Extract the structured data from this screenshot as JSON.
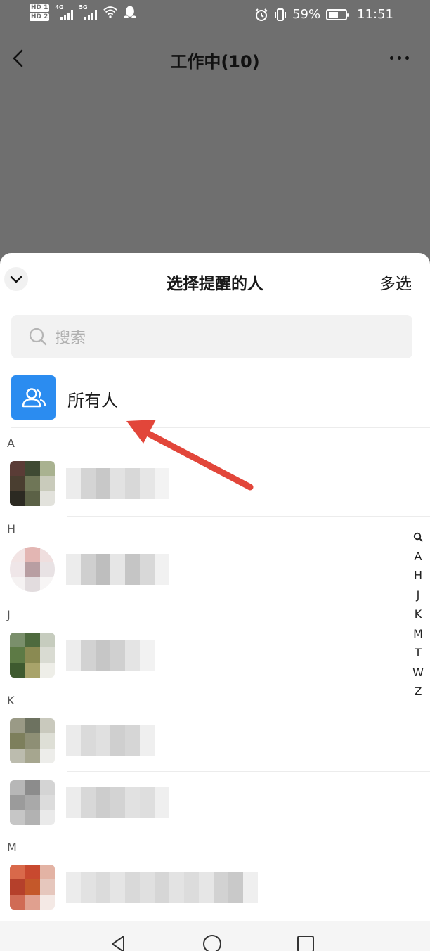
{
  "status_bar": {
    "sim1": "HD 1",
    "sim2": "HD 2",
    "net1": "4G",
    "net2": "5G",
    "battery": "59%",
    "battery_level": 0.59,
    "time": "11:51"
  },
  "topbar": {
    "title": "工作中(10)",
    "back_icon": "chevron-left-icon",
    "more_icon": "more-icon"
  },
  "sheet": {
    "title": "选择提醒的人",
    "multi_select": "多选",
    "collapse_icon": "chevron-down-icon",
    "search": {
      "placeholder": "搜索",
      "icon": "search-icon"
    },
    "all": {
      "label": "所有人",
      "icon": "group-icon",
      "accent": "#2b8cf0"
    },
    "sections": [
      {
        "letter": "A"
      },
      {
        "letter": "H"
      },
      {
        "letter": "J"
      },
      {
        "letter": "K"
      },
      {
        "letter": "M"
      }
    ],
    "index": [
      "A",
      "H",
      "J",
      "K",
      "M",
      "T",
      "W",
      "Z"
    ]
  },
  "annotation": {
    "color": "#e2463a"
  },
  "navbar": {
    "back": "triangle-back-icon",
    "home": "circle-home-icon",
    "recents": "square-recents-icon"
  }
}
